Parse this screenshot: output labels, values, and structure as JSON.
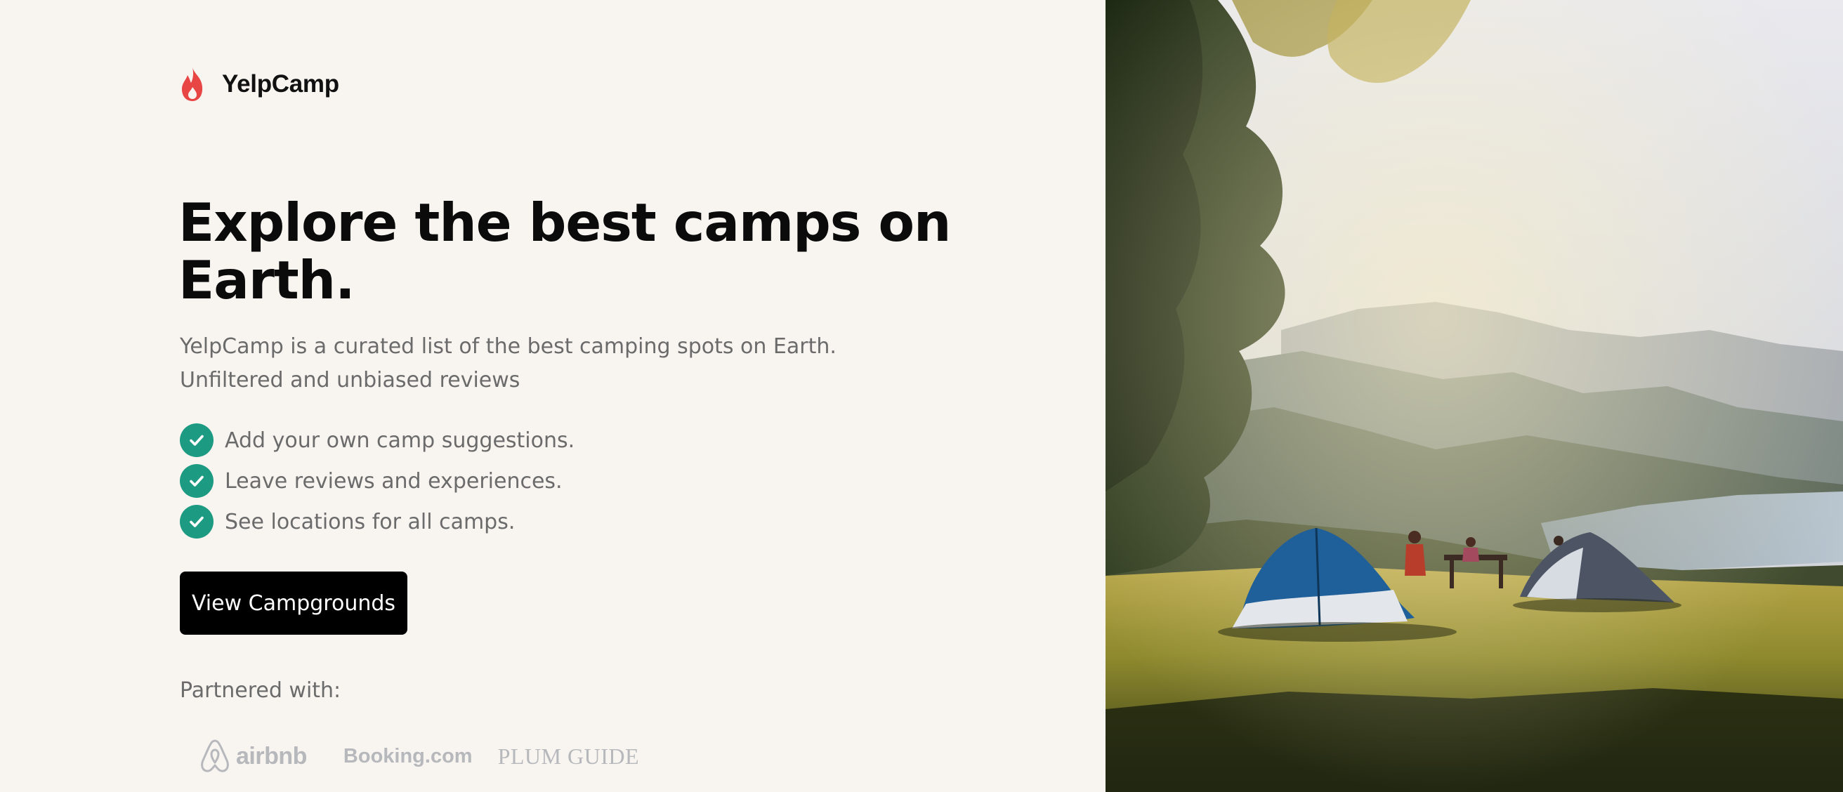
{
  "brand": {
    "name": "YelpCamp",
    "icon": "flame-icon",
    "color": "#e84545"
  },
  "hero": {
    "headline": "Explore the best camps on Earth.",
    "subtitle": "YelpCamp is a curated list of the best camping spots on Earth. Unfiltered and unbiased reviews",
    "features": [
      "Add your own camp suggestions.",
      "Leave reviews and experiences.",
      "See locations for all camps."
    ],
    "feature_icon": "check-circle-icon",
    "check_color": "#1d9a82",
    "cta_label": "View Campgrounds"
  },
  "partners": {
    "label": "Partnered with:",
    "logos": [
      "airbnb",
      "Booking.com",
      "PLUM GUIDE"
    ]
  },
  "photo": {
    "subject": "camping-tents-photo"
  }
}
